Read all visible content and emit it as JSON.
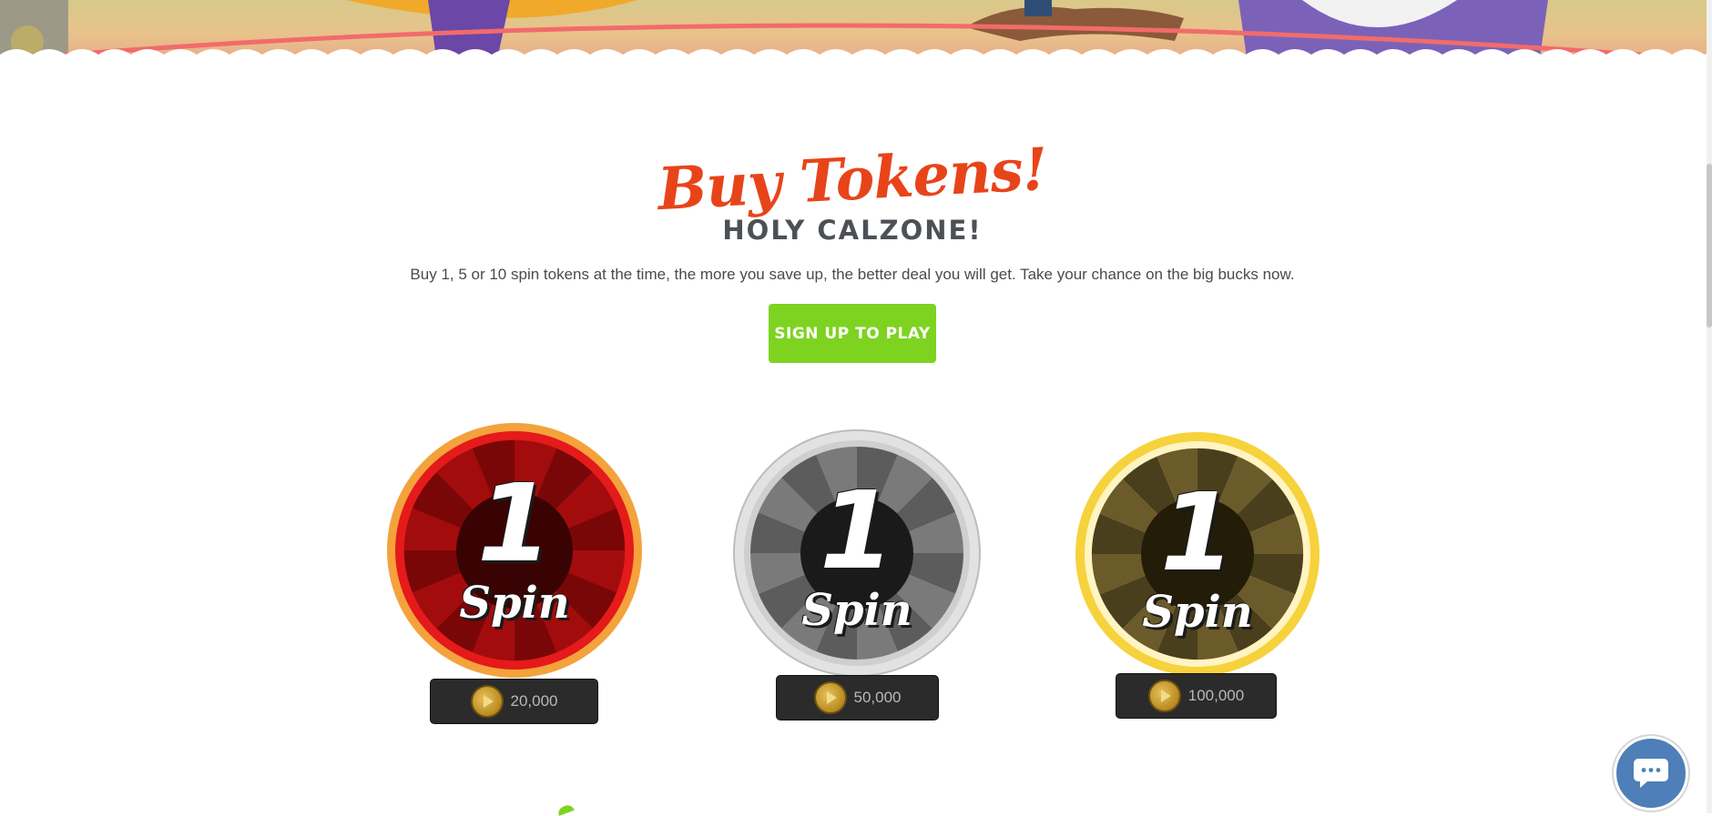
{
  "header": {
    "title": "Buy Tokens!",
    "subtitle": "HOLY CALZONE!",
    "description": "Buy 1, 5 or 10 spin tokens at the time, the more you save up, the better deal you will get. Take your chance on the big bucks now.",
    "cta_label": "SIGN UP TO PLAY"
  },
  "tokens": [
    {
      "number": "1",
      "word": "Spin",
      "price": "20,000",
      "theme": "red"
    },
    {
      "number": "1",
      "word": "Spin",
      "price": "50,000",
      "theme": "silver"
    },
    {
      "number": "1",
      "word": "Spin",
      "price": "100,000",
      "theme": "gold"
    }
  ],
  "colors": {
    "title": "#e8441a",
    "subtitle": "#4d5156",
    "cta": "#7ed321",
    "chat": "#4e7fb8",
    "price_bg": "#2b2b2b"
  },
  "icons": {
    "coin": "pizza-coin-icon",
    "chat": "chat-bubble-icon"
  }
}
